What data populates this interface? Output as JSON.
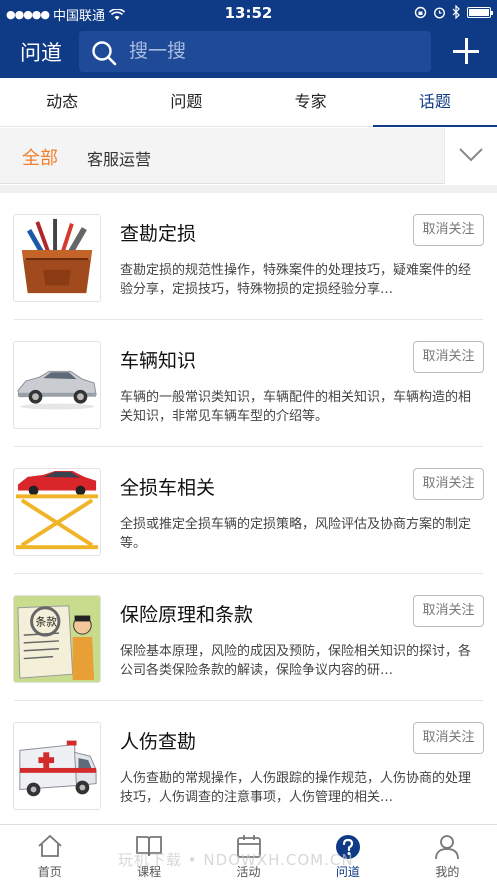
{
  "status_bar": {
    "carrier": "中国联通",
    "time": "13:52"
  },
  "header": {
    "title": "问道",
    "search_placeholder": "搜一搜",
    "brand_color": "#0f3a86"
  },
  "tabs": [
    {
      "label": "动态",
      "active": false
    },
    {
      "label": "问题",
      "active": false
    },
    {
      "label": "专家",
      "active": false
    },
    {
      "label": "话题",
      "active": true
    }
  ],
  "filter": {
    "all_label": "全部",
    "category": "客服运营",
    "all_color": "#ef7f2c"
  },
  "topics": [
    {
      "title": "查勘定损",
      "description": "查勘定损的规范性操作，特殊案件的处理技巧，疑难案件的经验分享，定损技巧，特殊物损的定损经验分享…",
      "button": "取消关注",
      "icon": "toolbox-icon"
    },
    {
      "title": "车辆知识",
      "description": "车辆的一般常识类知识，车辆配件的相关知识，车辆构造的相关知识，非常见车辆车型的介绍等。",
      "button": "取消关注",
      "icon": "car-icon"
    },
    {
      "title": "全损车相关",
      "description": "全损或推定全损车辆的定损策略，风险评估及协商方案的制定等。",
      "button": "取消关注",
      "icon": "car-lift-icon"
    },
    {
      "title": "保险原理和条款",
      "description": "保险基本原理，风险的成因及预防，保险相关知识的探讨，各公司各类保险条款的解读，保险争议内容的研…",
      "button": "取消关注",
      "icon": "clause-scroll-icon",
      "image_text": "条款"
    },
    {
      "title": "人伤查勘",
      "description": "人伤查勘的常规操作，人伤跟踪的操作规范，人伤协商的处理技巧，人伤调查的注意事项，人伤管理的相关…",
      "button": "取消关注",
      "icon": "ambulance-icon"
    }
  ],
  "bottom_nav": [
    {
      "label": "首页",
      "icon": "home-icon",
      "active": false
    },
    {
      "label": "课程",
      "icon": "book-icon",
      "active": false
    },
    {
      "label": "活动",
      "icon": "calendar-icon",
      "active": false
    },
    {
      "label": "问道",
      "icon": "question-icon",
      "active": true
    },
    {
      "label": "我的",
      "icon": "user-icon",
      "active": false
    }
  ],
  "watermark": "玩机下载 • NDOWXH.COM.CN"
}
